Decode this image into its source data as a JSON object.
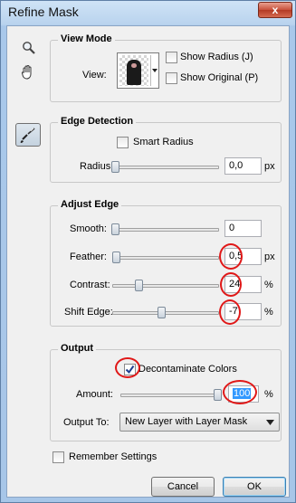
{
  "window": {
    "title": "Refine Mask",
    "close_glyph": "x"
  },
  "tools": {
    "zoom": "zoom-icon",
    "hand": "hand-icon",
    "brush": "refine-radius-brush-icon"
  },
  "view_mode": {
    "title": "View Mode",
    "view_label": "View:",
    "show_radius": "Show Radius (J)",
    "show_original": "Show Original (P)"
  },
  "edge_detection": {
    "title": "Edge Detection",
    "smart_radius": "Smart Radius",
    "radius_label": "Radius:",
    "radius_value": "0,0",
    "radius_unit": "px"
  },
  "adjust_edge": {
    "title": "Adjust Edge",
    "smooth_label": "Smooth:",
    "smooth_value": "0",
    "feather_label": "Feather:",
    "feather_value": "0,5",
    "feather_unit": "px",
    "contrast_label": "Contrast:",
    "contrast_value": "24",
    "contrast_unit": "%",
    "shift_label": "Shift Edge:",
    "shift_value": "-7",
    "shift_unit": "%"
  },
  "output": {
    "title": "Output",
    "decontaminate": "Decontaminate Colors",
    "decontaminate_checked": true,
    "amount_label": "Amount:",
    "amount_value": "100",
    "amount_unit": "%",
    "output_to_label": "Output To:",
    "output_to_value": "New Layer with Layer Mask"
  },
  "footer": {
    "remember": "Remember Settings",
    "cancel": "Cancel",
    "ok": "OK"
  }
}
